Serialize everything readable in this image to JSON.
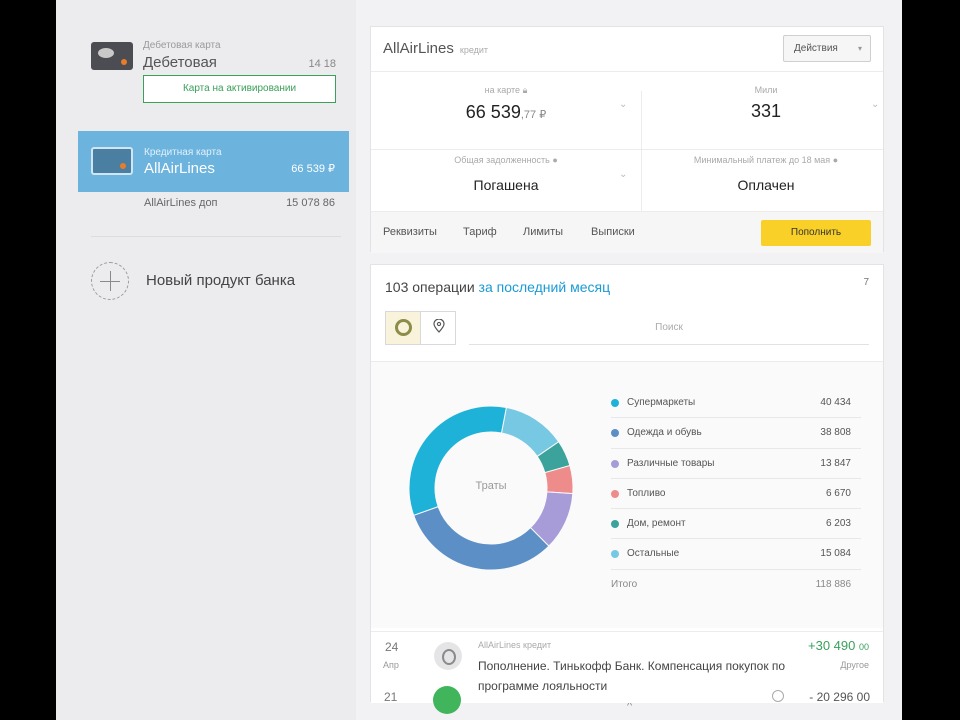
{
  "sidebar": {
    "product1": {
      "type": "Дебетовая карта",
      "name": "Дебетовая",
      "balance": "14 18",
      "activate_label": "Карта на активировании"
    },
    "product2": {
      "type": "Кредитная карта",
      "name": "AllAirLines",
      "balance": "66 539 ₽"
    },
    "sub_card": {
      "name": "AllAirLines доп",
      "balance": "15 078 86"
    },
    "new_product": {
      "label": "Новый продукт банка"
    }
  },
  "account": {
    "title": "AllAirLines",
    "subtitle": "кредит",
    "actions_label": "Действия",
    "on_card": {
      "label": "на карте",
      "value": "66 539",
      "decimals": ",77 ₽"
    },
    "miles": {
      "label": "Мили",
      "value": "331"
    },
    "debt": {
      "label": "Общая задолженность",
      "value": "Погашена"
    },
    "min_payment": {
      "label": "Минимальный платеж до 18 мая",
      "value": "Оплачен"
    },
    "tabs": [
      "Реквизиты",
      "Тариф",
      "Лимиты",
      "Выписки"
    ],
    "pay_label": "Пополнить"
  },
  "operations": {
    "count_text": "103 операции",
    "period_link": "за последний месяц",
    "header_number": "7",
    "search_placeholder": "Поиск",
    "collapse_icon": "chevron-up-icon",
    "chart_center_label": "Траты",
    "chart_data": {
      "type": "pie",
      "categories": [
        "Супермаркеты",
        "Одежда и обувь",
        "Различные товары",
        "Топливо",
        "Дом, ремонт",
        "Остальное"
      ],
      "values": [
        40434,
        38808,
        13847,
        6670,
        6203,
        15084
      ],
      "colors": [
        "#1fb2d8",
        "#5b8fc5",
        "#a79cd7",
        "#ee8c8c",
        "#3ba39b",
        "#77c8e3"
      ]
    },
    "legend": [
      {
        "name": "Супермаркеты",
        "value": "40 434",
        "color": "#1fb2d8"
      },
      {
        "name": "Одежда и обувь",
        "value": "38 808",
        "color": "#5b8fc5"
      },
      {
        "name": "Различные товары",
        "value": "13 847",
        "color": "#a79cd7"
      },
      {
        "name": "Топливо",
        "value": "6 670",
        "color": "#ee8c8c"
      },
      {
        "name": "Дом, ремонт",
        "value": "6 203",
        "color": "#3ba39b"
      },
      {
        "name": "Остальные",
        "value": "15 084",
        "color": "#77c8e3"
      }
    ],
    "total": {
      "name": "Итого",
      "value": "118 886"
    },
    "op1": {
      "day": "24",
      "month": "Апр",
      "source": "AllAirLines кредит",
      "text": "Пополнение. Тинькофф Банк. Компенсация покупок по программе лояльности",
      "amount": "+30 490",
      "amount_decimals": "00",
      "category": "Другое"
    },
    "op2": {
      "day": "21",
      "amount": "- 20 296 00"
    }
  }
}
